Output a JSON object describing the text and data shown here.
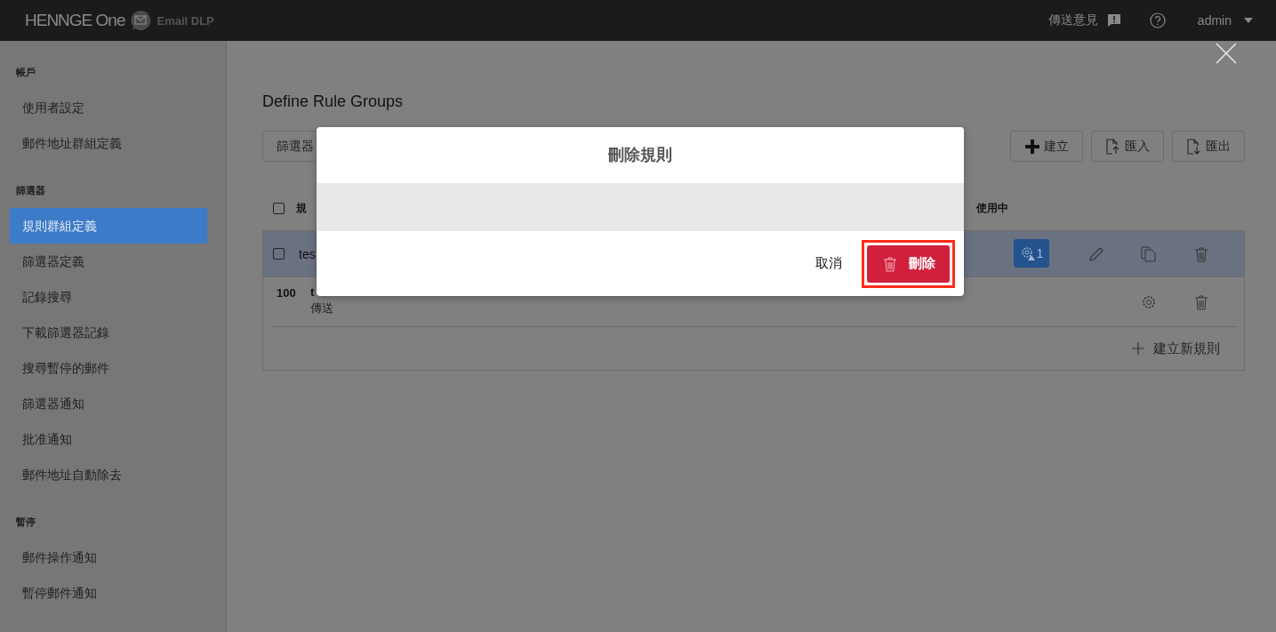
{
  "header": {
    "logo": "HENNGE One",
    "product": "Email DLP",
    "feedback": "傳送意見",
    "user": "admin"
  },
  "sidebar": {
    "sections": [
      {
        "title": "帳戶",
        "items": [
          {
            "label": "使用者設定",
            "selected": false
          },
          {
            "label": "郵件地址群組定義",
            "selected": false
          }
        ]
      },
      {
        "title": "篩選器",
        "items": [
          {
            "label": "規則群組定義",
            "selected": true
          },
          {
            "label": "篩選器定義",
            "selected": false
          },
          {
            "label": "記錄搜尋",
            "selected": false
          },
          {
            "label": "下載篩選器記錄",
            "selected": false
          },
          {
            "label": "搜尋暫停的郵件",
            "selected": false
          },
          {
            "label": "篩選器通知",
            "selected": false
          },
          {
            "label": "批准通知",
            "selected": false
          },
          {
            "label": "郵件地址自動除去",
            "selected": false
          }
        ]
      },
      {
        "title": "暫停",
        "items": [
          {
            "label": "郵件操作通知",
            "selected": false
          },
          {
            "label": "暫停郵件通知",
            "selected": false
          }
        ]
      }
    ]
  },
  "page": {
    "title": "Define Rule Groups",
    "filter_button": "篩選器",
    "toolbar": [
      {
        "kind": "create",
        "label": "建立"
      },
      {
        "kind": "import",
        "label": "匯入"
      },
      {
        "kind": "export",
        "label": "匯出"
      }
    ]
  },
  "table": {
    "select_all": {
      "checked": false
    },
    "column_1": "規",
    "column_active": "使用中",
    "rows": [
      {
        "kind": "group",
        "checked": false,
        "selected": true,
        "name": "tes",
        "badge": "1"
      },
      {
        "kind": "rule",
        "selected": false,
        "priority": "100",
        "name": "t",
        "action": "傳送"
      }
    ],
    "add_rule": "建立新規則"
  },
  "dialog": {
    "title": "刪除規則",
    "cancel": "取消",
    "delete": "刪除",
    "highlighted": true
  }
}
